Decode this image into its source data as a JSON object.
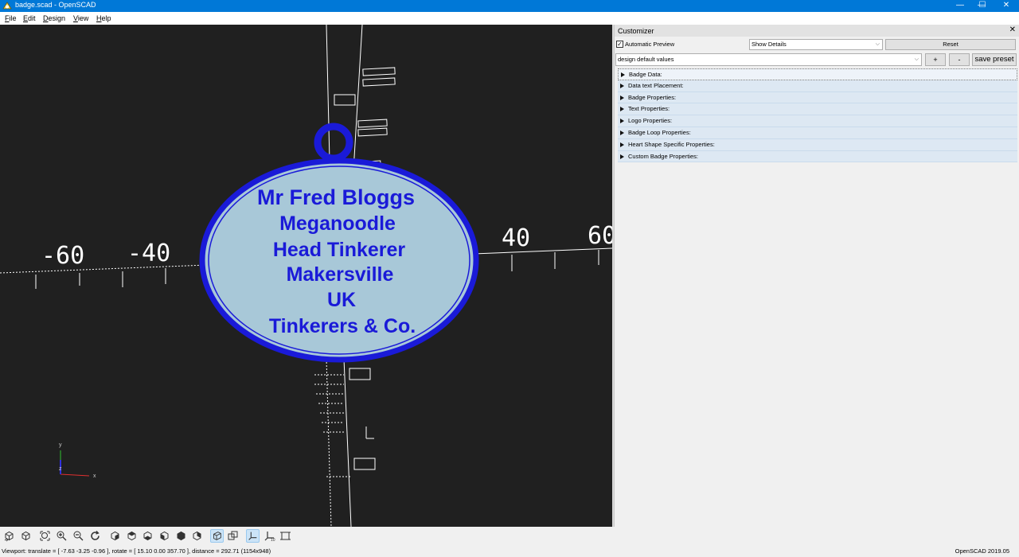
{
  "window": {
    "title": "badge.scad - OpenSCAD",
    "controls": {
      "minimize": "—",
      "maximize": "☐",
      "close": "✕"
    }
  },
  "menu": [
    "File",
    "Edit",
    "Design",
    "View",
    "Help"
  ],
  "viewport": {
    "badge_lines": [
      "Mr Fred Bloggs",
      "Meganoodle",
      "Head Tinkerer",
      "Makersville",
      "UK",
      "Tinkerers & Co."
    ],
    "axis_labels": [
      "-60",
      "-40",
      "40",
      "60"
    ],
    "badge_fill_color": "#a8c8d8",
    "badge_rim_color": "#1a1ad8",
    "background_color": "#202020",
    "gizmo_labels": {
      "x": "x",
      "y": "y",
      "z": "z"
    }
  },
  "toolbar": {
    "buttons": [
      "preview",
      "render",
      "view-all",
      "zoom-in",
      "zoom-out",
      "reset-view",
      "view-right",
      "view-top",
      "view-bottom",
      "view-left",
      "view-front",
      "view-back",
      "perspective",
      "orthogonal",
      "show-axes",
      "show-scale-markers",
      "show-edges"
    ]
  },
  "status": {
    "viewport_info": "Viewport: translate = [ -7.63 -3.25 -0.96 ], rotate = [ 15.10 0.00 357.70 ], distance = 292.71 (1154x948)",
    "version": "OpenSCAD 2019.05"
  },
  "customizer": {
    "title": "Customizer",
    "close": "✕",
    "automatic_preview_label": "Automatic Preview",
    "automatic_preview_checked": "✓",
    "details_select": "Show Details",
    "reset_label": "Reset",
    "preset_select": "design default values",
    "plus_label": "+",
    "minus_label": "-",
    "save_preset_label": "save preset",
    "groups": [
      "Badge Data:",
      "Data text Placement:",
      "Badge Properties:",
      "Text Properties:",
      "Logo Properties:",
      "Badge Loop Properties:",
      "Heart Shape Specific Properties:",
      "Custom Badge Properties:"
    ]
  }
}
